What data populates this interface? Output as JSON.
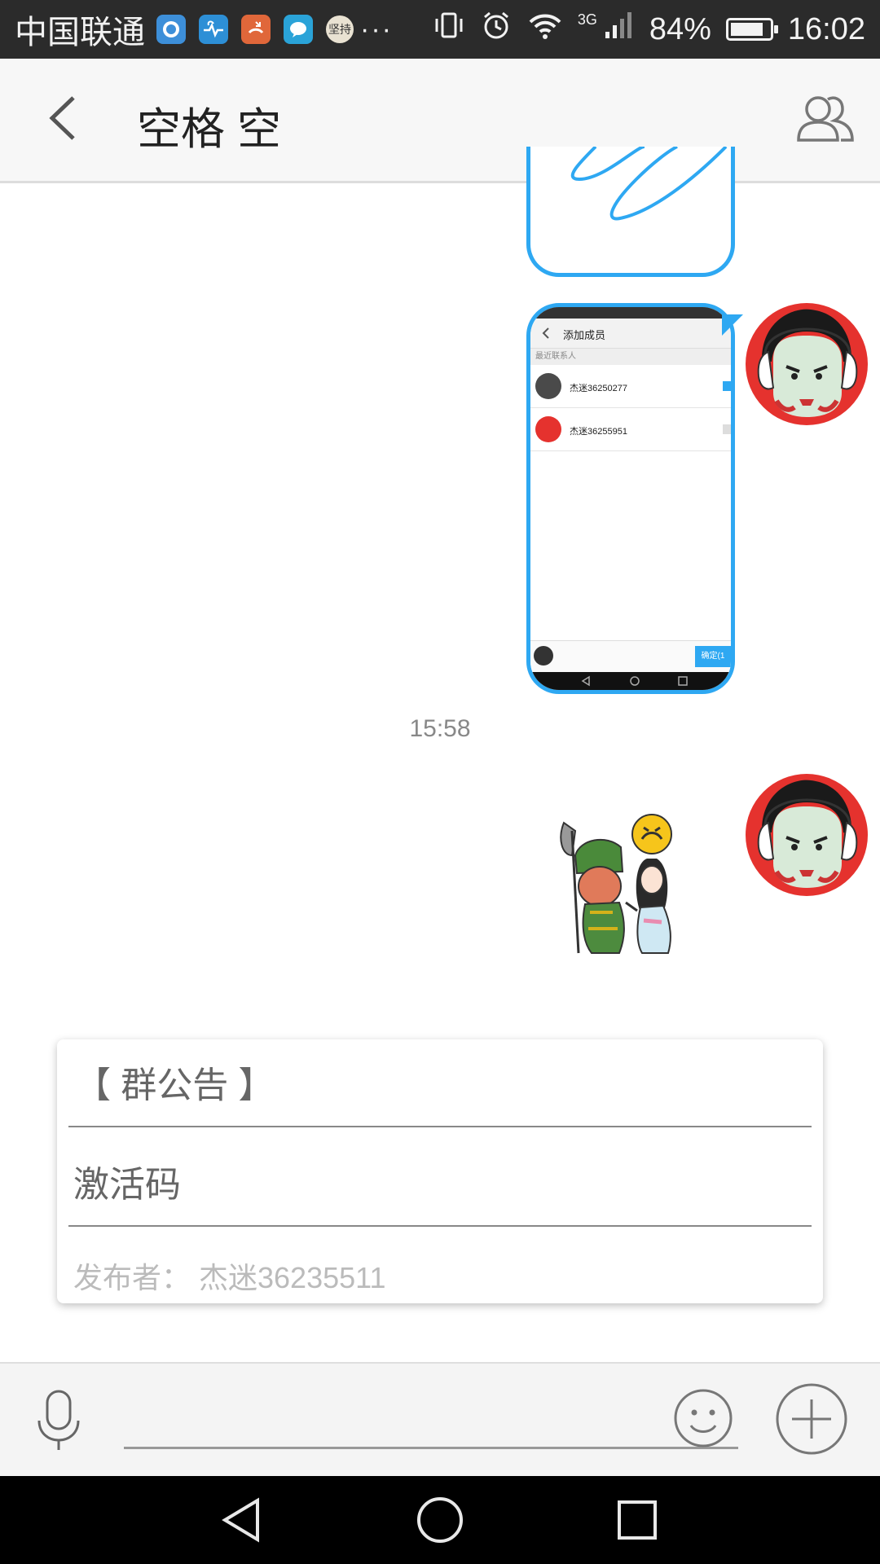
{
  "status_bar": {
    "carrier": "中国联通",
    "app_icons": [
      "qq-icon",
      "health-icon",
      "phone-icon",
      "messages-icon",
      "jianchi-app-icon"
    ],
    "app_icon_label": "坚持",
    "more": "···",
    "network_type": "3G",
    "battery_percent": "84%",
    "battery_level": 0.84,
    "time": "16:02"
  },
  "header": {
    "title": "空格 空"
  },
  "messages": {
    "screenshot": {
      "title": "添加成员",
      "section": "最近联系人",
      "contacts": [
        "杰迷36250277",
        "杰迷36255951"
      ],
      "confirm": "确定(1"
    },
    "timestamp": "15:58"
  },
  "announcement": {
    "title": "【 群公告 】",
    "body": "激活码",
    "author": "发布者： 杰迷36235511"
  },
  "input": {
    "placeholder": ""
  },
  "colors": {
    "accent": "#2ea8f2",
    "avatar_bg": "#e5322e",
    "status_bg": "#2b2b2b"
  }
}
